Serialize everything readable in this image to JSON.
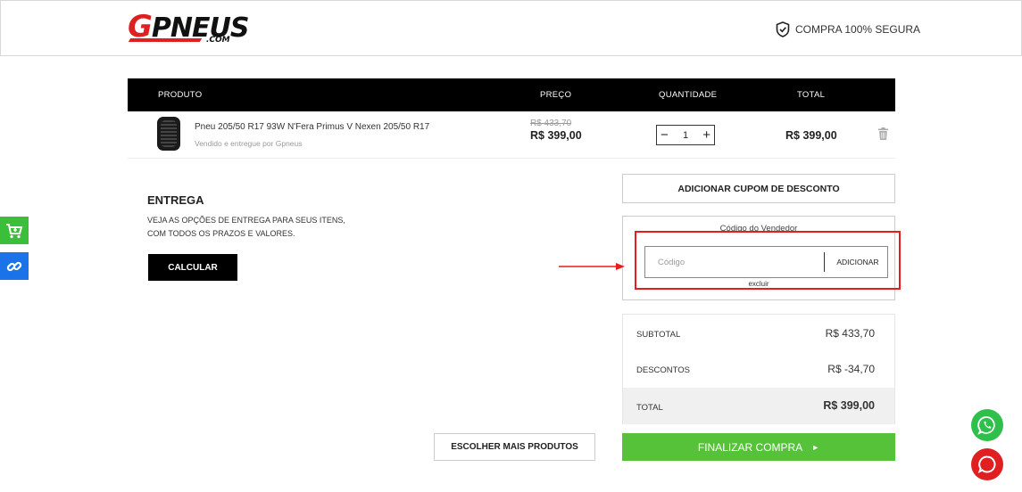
{
  "header": {
    "logo_text": "GPNEUS",
    "logo_suffix": ".COM",
    "secure_label": "COMPRA 100% SEGURA"
  },
  "table": {
    "headers": {
      "product": "PRODUTO",
      "price": "PREÇO",
      "quantity": "QUANTIDADE",
      "total": "TOTAL"
    },
    "items": [
      {
        "name": "Pneu 205/50 R17 93W N'Fera Primus V Nexen 205/50 R17",
        "seller": "Vendido e entregue por Gpneus",
        "old_price": "R$ 433,70",
        "price": "R$ 399,00",
        "quantity": "1",
        "total": "R$ 399,00"
      }
    ]
  },
  "delivery": {
    "title": "ENTREGA",
    "desc_line1": "VEJA AS OPÇÕES DE ENTREGA PARA SEUS ITENS,",
    "desc_line2": "COM TODOS OS PRAZOS E VALORES.",
    "button": "CALCULAR"
  },
  "coupon": {
    "button": "ADICIONAR CUPOM DE DESCONTO"
  },
  "vendor": {
    "label": "Código do Vendedor",
    "placeholder": "Código",
    "add_button": "ADICIONAR",
    "remove_link": "excluir"
  },
  "summary": {
    "subtotal_label": "SUBTOTAL",
    "subtotal_value": "R$ 433,70",
    "discount_label": "DESCONTOS",
    "discount_value": "R$ -34,70",
    "total_label": "TOTAL",
    "total_value": "R$ 399,00"
  },
  "actions": {
    "more_products": "ESCOLHER MAIS PRODUTOS",
    "finish": "FINALIZAR COMPRA",
    "finish_arrow": "►"
  },
  "colors": {
    "accent_red": "#e02020",
    "finish_green": "#56c23a",
    "whatsapp_green": "#2ec04a",
    "link_blue": "#1a73e8"
  },
  "icons": [
    "shield-check-icon",
    "trash-icon",
    "cart-icon",
    "link-icon",
    "whatsapp-icon",
    "chat-icon"
  ]
}
